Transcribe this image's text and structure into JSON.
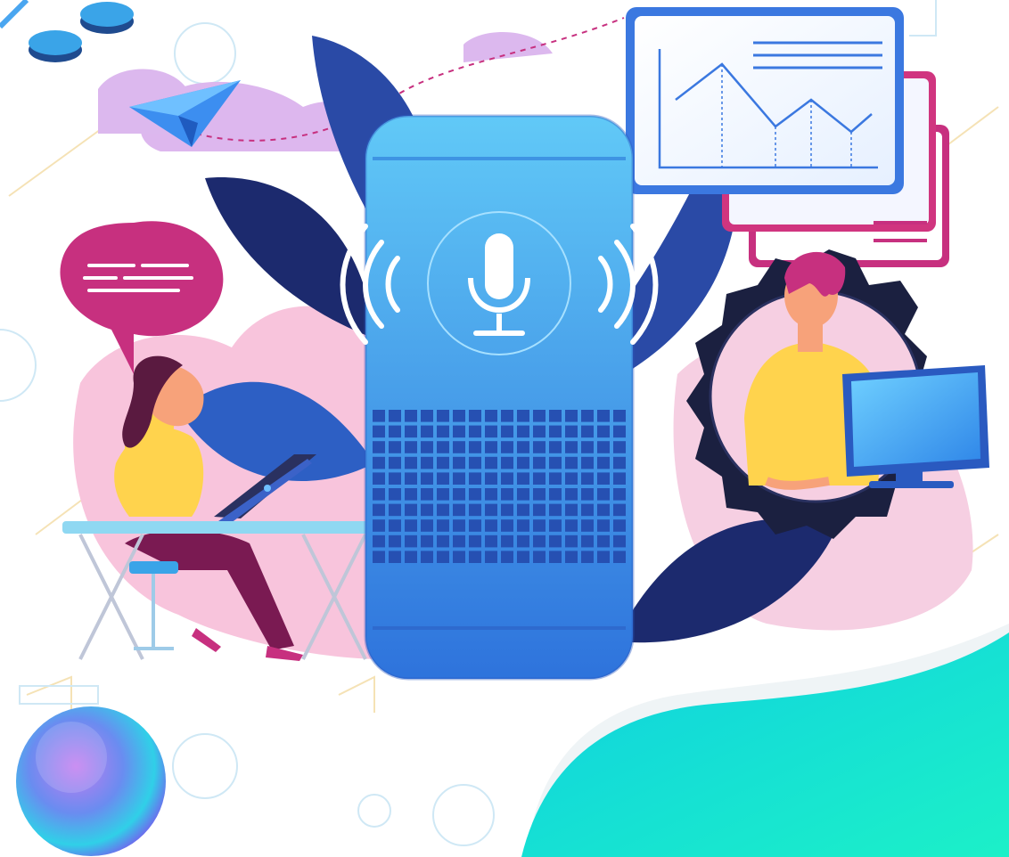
{
  "illustration": {
    "elements": [
      "voice-assistant-speaker",
      "microphone-icon",
      "sound-wave-icons",
      "chart-panels",
      "woman-at-desk-with-laptop",
      "speech-bubble",
      "man-in-gear-with-monitor",
      "paper-plane",
      "clouds",
      "leaves",
      "iridescent-sphere",
      "teal-wave"
    ]
  },
  "colors": {
    "speaker_top": "#5ec6f6",
    "speaker_bottom": "#2f7de0",
    "leaf_dark": "#1c2a6e",
    "leaf_blue": "#2d5fc4",
    "pink_blob": "#f6c6dc",
    "lavender": "#d7b6ea",
    "magenta": "#c7307f",
    "yellow_shirt": "#ffd34d",
    "teal_wave": "#19e6d2",
    "gear": "#1b2040"
  }
}
